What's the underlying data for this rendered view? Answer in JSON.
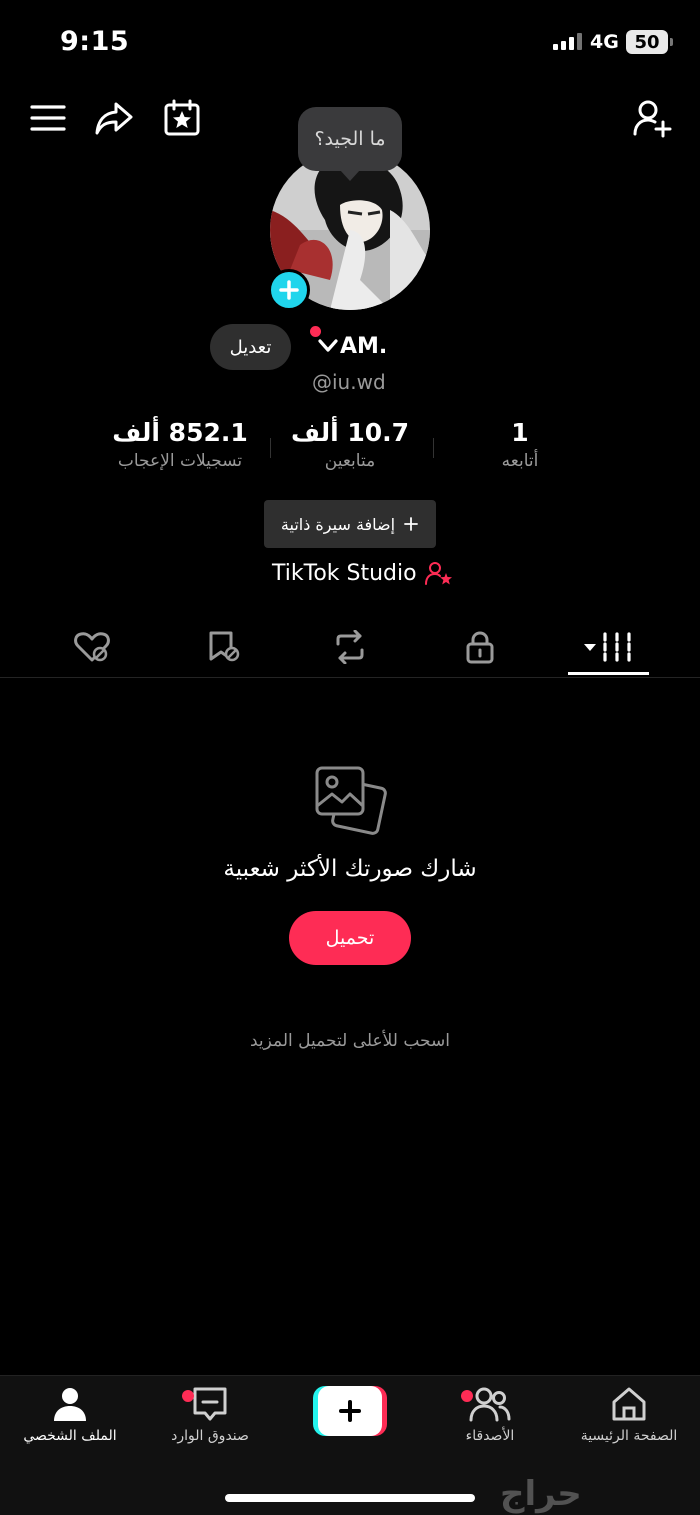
{
  "status_bar": {
    "time": "9:15",
    "network": "4G",
    "battery": "50"
  },
  "tooltip": "ما الجيد؟",
  "profile": {
    "edit_label": "تعديل",
    "display_name": "AM.",
    "username": "@iu.wd"
  },
  "stats": [
    {
      "value": "852.1 ألف",
      "label": "تسجيلات الإعجاب"
    },
    {
      "value": "10.7 ألف",
      "label": "متابعين"
    },
    {
      "value": "1",
      "label": "أتابعه"
    }
  ],
  "bio_button": "إضافة سيرة ذاتية",
  "studio_link": "TikTok Studio",
  "empty_state": {
    "title": "شارك صورتك الأكثر شعبية",
    "upload_label": "تحميل",
    "hint": "اسحب للأعلى لتحميل المزيد"
  },
  "bottom_nav": {
    "profile": "الملف الشخصي",
    "inbox": "صندوق الوارد",
    "friends": "الأصدقاء",
    "home": "الصفحة الرئيسية"
  },
  "watermark": "حراج",
  "colors": {
    "accent": "#fe2c55",
    "cyan": "#25f4ee",
    "background": "#000000"
  }
}
